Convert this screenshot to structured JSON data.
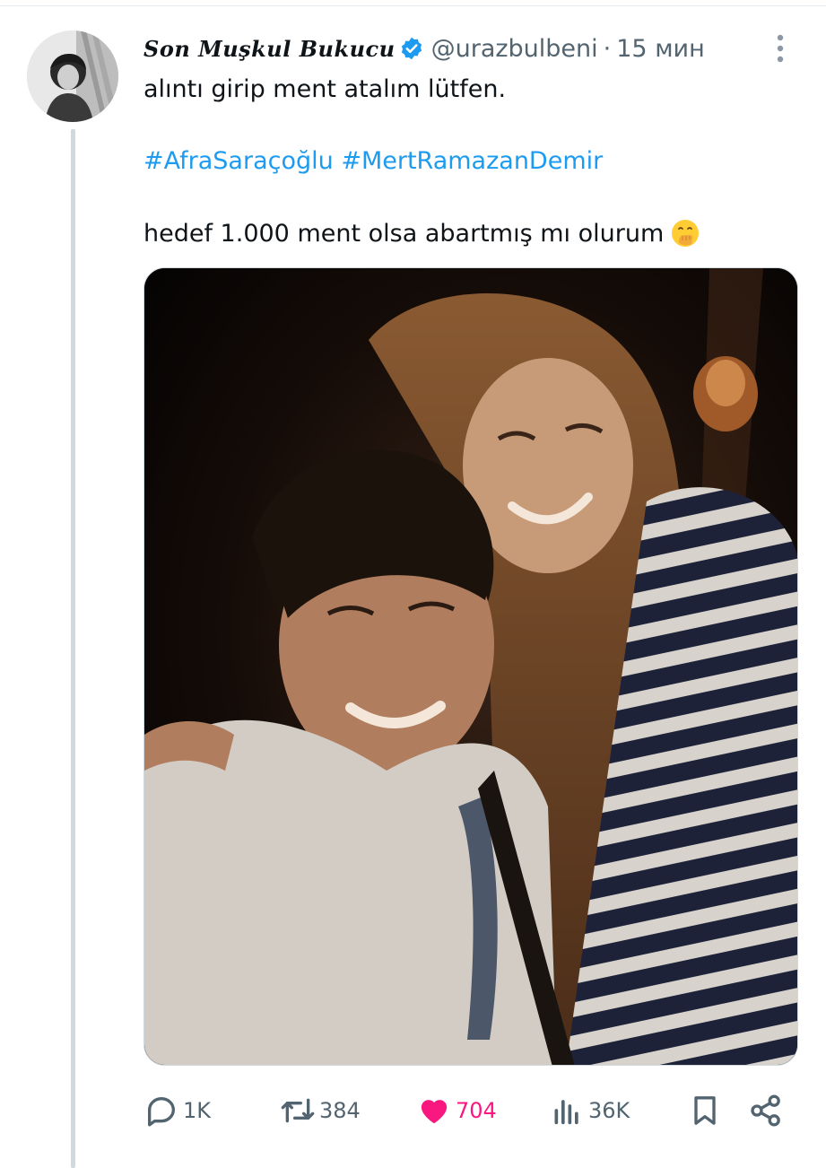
{
  "tweet": {
    "display_name": "Son Muşkul Bukucu",
    "handle": "@urazbulbeni",
    "separator": "·",
    "time": "15 мин",
    "text_line1": "alıntı girip ment atalım lütfen.",
    "hashtags": [
      "#AfraSaraçoğlu",
      "#MertRamazanDemir"
    ],
    "text_line3": "hedef 1.000 ment olsa abartmış mı olurum",
    "emoji": "face-with-hand-over-mouth",
    "media": "photo of a smiling couple at night"
  },
  "actions": {
    "reply_count": "1K",
    "retweet_count": "384",
    "like_count": "704",
    "views_count": "36K"
  },
  "icons": {
    "verified": "verified-badge-icon",
    "more": "more-vertical-icon",
    "reply": "reply-icon",
    "retweet": "retweet-icon",
    "like": "heart-icon",
    "views": "views-icon",
    "bookmark": "bookmark-icon",
    "share": "share-icon"
  },
  "colors": {
    "link": "#1d9bf0",
    "meta": "#536471",
    "like": "#f91880",
    "thread_line": "#cfd9de"
  }
}
